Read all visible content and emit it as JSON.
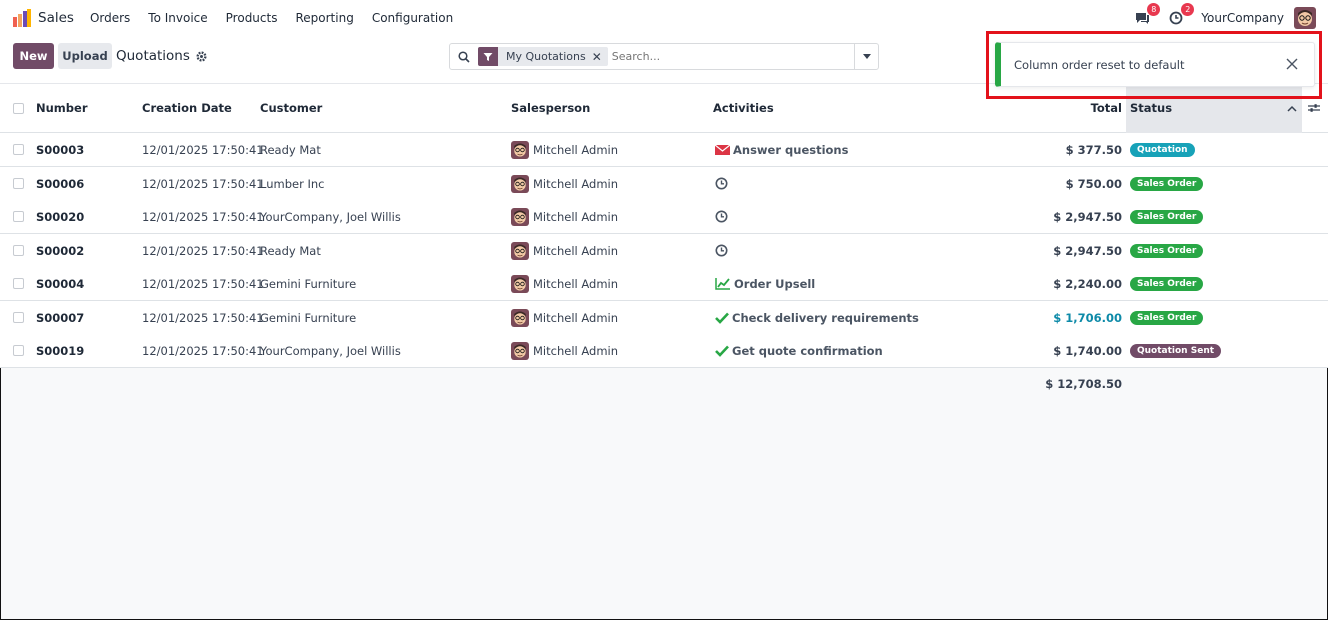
{
  "navbar": {
    "app_name": "Sales",
    "menu": [
      "Orders",
      "To Invoice",
      "Products",
      "Reporting",
      "Configuration"
    ],
    "messages_count": "8",
    "activities_count": "2",
    "company": "YourCompany"
  },
  "control": {
    "new_label": "New",
    "upload_label": "Upload",
    "breadcrumb": "Quotations",
    "facet_label": "My Quotations",
    "facet_remove": "✕",
    "search_placeholder": "Search..."
  },
  "table": {
    "headers": {
      "number": "Number",
      "creation_date": "Creation Date",
      "customer": "Customer",
      "salesperson": "Salesperson",
      "activities": "Activities",
      "total": "Total",
      "status": "Status"
    },
    "rows": [
      {
        "number": "S00003",
        "date": "12/01/2025 17:50:41",
        "customer": "Ready Mat",
        "salesperson": "Mitchell Admin",
        "activity": "Answer questions",
        "activity_icon": "envelope-icon",
        "total": "$ 377.50",
        "status": "Quotation",
        "status_color": "#17a2b8"
      },
      {
        "number": "S00006",
        "date": "12/01/2025 17:50:41",
        "customer": "Lumber Inc",
        "salesperson": "Mitchell Admin",
        "activity": "",
        "activity_icon": "clock-icon",
        "total": "$ 750.00",
        "status": "Sales Order",
        "status_color": "#28a745"
      },
      {
        "number": "S00020",
        "date": "12/01/2025 17:50:41",
        "customer": "YourCompany, Joel Willis",
        "salesperson": "Mitchell Admin",
        "activity": "",
        "activity_icon": "clock-icon",
        "total": "$ 2,947.50",
        "status": "Sales Order",
        "status_color": "#28a745"
      },
      {
        "number": "S00002",
        "date": "12/01/2025 17:50:41",
        "customer": "Ready Mat",
        "salesperson": "Mitchell Admin",
        "activity": "",
        "activity_icon": "clock-icon",
        "total": "$ 2,947.50",
        "status": "Sales Order",
        "status_color": "#28a745"
      },
      {
        "number": "S00004",
        "date": "12/01/2025 17:50:41",
        "customer": "Gemini Furniture",
        "salesperson": "Mitchell Admin",
        "activity": "Order Upsell",
        "activity_icon": "chart-line-icon",
        "total": "$ 2,240.00",
        "status": "Sales Order",
        "status_color": "#28a745"
      },
      {
        "number": "S00007",
        "date": "12/01/2025 17:50:41",
        "customer": "Gemini Furniture",
        "salesperson": "Mitchell Admin",
        "activity": "Check delivery requirements",
        "activity_icon": "check-icon",
        "total": "$ 1,706.00",
        "total_color": "#0d8aa8",
        "status": "Sales Order",
        "status_color": "#28a745"
      },
      {
        "number": "S00019",
        "date": "12/01/2025 17:50:41",
        "customer": "YourCompany, Joel Willis",
        "salesperson": "Mitchell Admin",
        "activity": "Get quote confirmation",
        "activity_icon": "check-icon",
        "total": "$ 1,740.00",
        "status": "Quotation Sent",
        "status_color": "#714b67"
      }
    ],
    "grand_total": "$ 12,708.50"
  },
  "toast": {
    "message": "Column order reset to default",
    "accent": "#28a745"
  },
  "colors": {
    "brand": "#714b67",
    "highlight": "#e3121b"
  }
}
